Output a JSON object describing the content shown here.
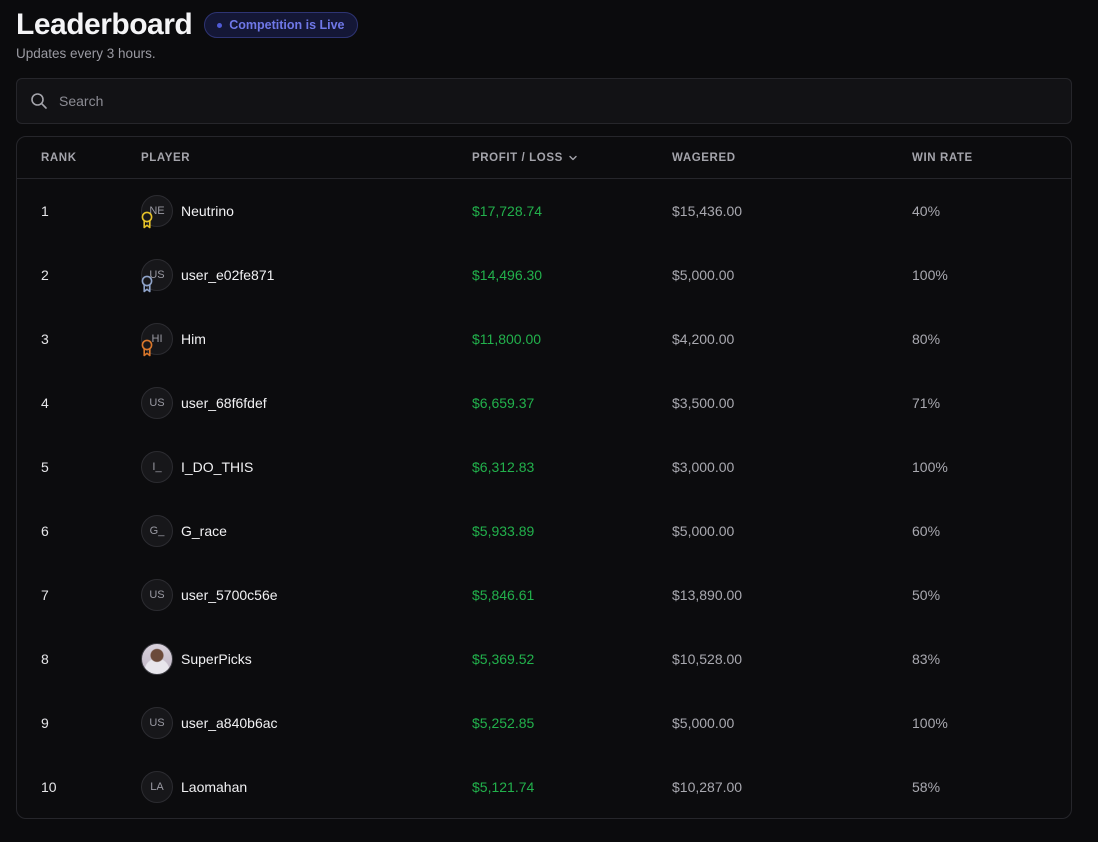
{
  "header": {
    "title": "Leaderboard",
    "badge": "Competition is Live",
    "subtitle": "Updates every 3 hours."
  },
  "search": {
    "placeholder": "Search",
    "value": ""
  },
  "table": {
    "columns": {
      "rank": "RANK",
      "player": "PLAYER",
      "profit": "PROFIT / LOSS",
      "wagered": "WAGERED",
      "winrate": "WIN RATE"
    },
    "rows": [
      {
        "rank": "1",
        "initials": "NE",
        "name": "Neutrino",
        "profit": "$17,728.74",
        "wagered": "$15,436.00",
        "winrate": "40%",
        "medal": "gold"
      },
      {
        "rank": "2",
        "initials": "US",
        "name": "user_e02fe871",
        "profit": "$14,496.30",
        "wagered": "$5,000.00",
        "winrate": "100%",
        "medal": "silver"
      },
      {
        "rank": "3",
        "initials": "HI",
        "name": "Him",
        "profit": "$11,800.00",
        "wagered": "$4,200.00",
        "winrate": "80%",
        "medal": "bronze"
      },
      {
        "rank": "4",
        "initials": "US",
        "name": "user_68f6fdef",
        "profit": "$6,659.37",
        "wagered": "$3,500.00",
        "winrate": "71%"
      },
      {
        "rank": "5",
        "initials": "I_",
        "name": "I_DO_THIS",
        "profit": "$6,312.83",
        "wagered": "$3,000.00",
        "winrate": "100%"
      },
      {
        "rank": "6",
        "initials": "G_",
        "name": "G_race",
        "profit": "$5,933.89",
        "wagered": "$5,000.00",
        "winrate": "60%"
      },
      {
        "rank": "7",
        "initials": "US",
        "name": "user_5700c56e",
        "profit": "$5,846.61",
        "wagered": "$13,890.00",
        "winrate": "50%"
      },
      {
        "rank": "8",
        "initials": "",
        "name": "SuperPicks",
        "profit": "$5,369.52",
        "wagered": "$10,528.00",
        "winrate": "83%",
        "photo": true
      },
      {
        "rank": "9",
        "initials": "US",
        "name": "user_a840b6ac",
        "profit": "$5,252.85",
        "wagered": "$5,000.00",
        "winrate": "100%"
      },
      {
        "rank": "10",
        "initials": "LA",
        "name": "Laomahan",
        "profit": "$5,121.74",
        "wagered": "$10,287.00",
        "winrate": "58%"
      }
    ]
  },
  "colors": {
    "background": "#0b0b0d",
    "profit_green": "#22b14c",
    "badge_accent": "#6f78e8",
    "medal_gold": "#e6c229",
    "medal_silver": "#8fa3c9",
    "medal_bronze": "#d9772b"
  }
}
